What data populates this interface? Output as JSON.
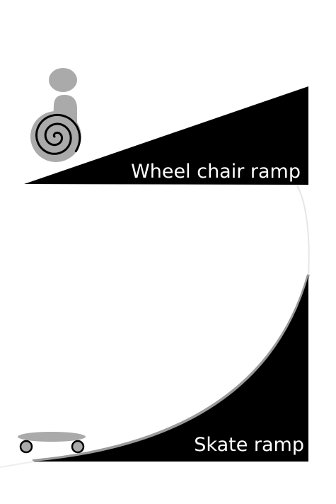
{
  "diagram": {
    "wheelchair_ramp": {
      "label": "Wheel chair ramp",
      "ramp_color": "#000000",
      "figure_color": "#aaaaaa",
      "wheel_icon": "spiral-wheel-icon"
    },
    "skate_ramp": {
      "label": "Skate ramp",
      "ramp_color": "#000000",
      "board_color": "#aaaaaa",
      "wheel_icon": "skateboard-wheel-icon"
    },
    "background_color": "#ffffff"
  }
}
